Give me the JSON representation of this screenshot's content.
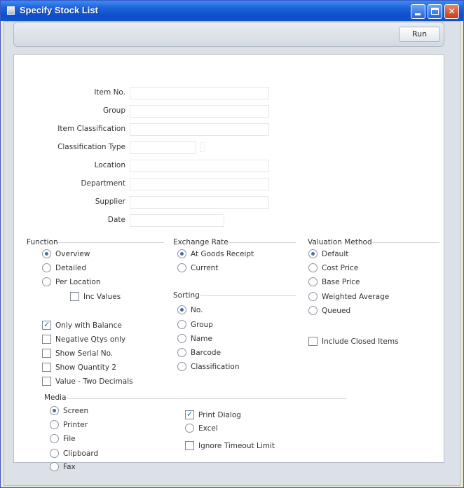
{
  "window": {
    "title": "Specify Stock List"
  },
  "toolbar": {
    "run_label": "Run"
  },
  "fields": {
    "item_no": {
      "label": "Item No.",
      "value": ""
    },
    "group": {
      "label": "Group",
      "value": ""
    },
    "item_classification": {
      "label": "Item Classification",
      "value": ""
    },
    "classification_type": {
      "label": "Classification Type",
      "value": ""
    },
    "location": {
      "label": "Location",
      "value": ""
    },
    "department": {
      "label": "Department",
      "value": ""
    },
    "supplier": {
      "label": "Supplier",
      "value": ""
    },
    "date": {
      "label": "Date",
      "value": ""
    }
  },
  "function": {
    "heading": "Function",
    "options": [
      {
        "label": "Overview",
        "selected": true
      },
      {
        "label": "Detailed",
        "selected": false
      },
      {
        "label": "Per Location",
        "selected": false
      }
    ],
    "inc_values": {
      "label": "Inc Values",
      "checked": false
    }
  },
  "exchange_rate": {
    "heading": "Exchange Rate",
    "options": [
      {
        "label": "At Goods Receipt",
        "selected": true
      },
      {
        "label": "Current",
        "selected": false
      }
    ]
  },
  "valuation_method": {
    "heading": "Valuation Method",
    "options": [
      {
        "label": "Default",
        "selected": true
      },
      {
        "label": "Cost Price",
        "selected": false
      },
      {
        "label": "Base Price",
        "selected": false
      },
      {
        "label": "Weighted Average",
        "selected": false
      },
      {
        "label": "Queued",
        "selected": false
      }
    ]
  },
  "sorting": {
    "heading": "Sorting",
    "options": [
      {
        "label": "No.",
        "selected": true
      },
      {
        "label": "Group",
        "selected": false
      },
      {
        "label": "Name",
        "selected": false
      },
      {
        "label": "Barcode",
        "selected": false
      },
      {
        "label": "Classification",
        "selected": false
      }
    ]
  },
  "checkboxes": [
    {
      "label": "Only with Balance",
      "checked": true
    },
    {
      "label": "Negative Qtys only",
      "checked": false
    },
    {
      "label": "Show Serial No.",
      "checked": false
    },
    {
      "label": "Show Quantity 2",
      "checked": false
    },
    {
      "label": "Value - Two Decimals",
      "checked": false
    }
  ],
  "include_closed": {
    "label": "Include Closed Items",
    "checked": false
  },
  "media": {
    "heading": "Media",
    "options": [
      {
        "label": "Screen",
        "selected": true
      },
      {
        "label": "Printer",
        "selected": false
      },
      {
        "label": "File",
        "selected": false
      },
      {
        "label": "Clipboard",
        "selected": false
      },
      {
        "label": "Fax",
        "selected": false
      }
    ],
    "print_dialog": {
      "label": "Print Dialog",
      "checked": true
    },
    "excel": {
      "label": "Excel",
      "selected": false
    },
    "ignore_timeout": {
      "label": "Ignore Timeout Limit",
      "checked": false
    }
  }
}
